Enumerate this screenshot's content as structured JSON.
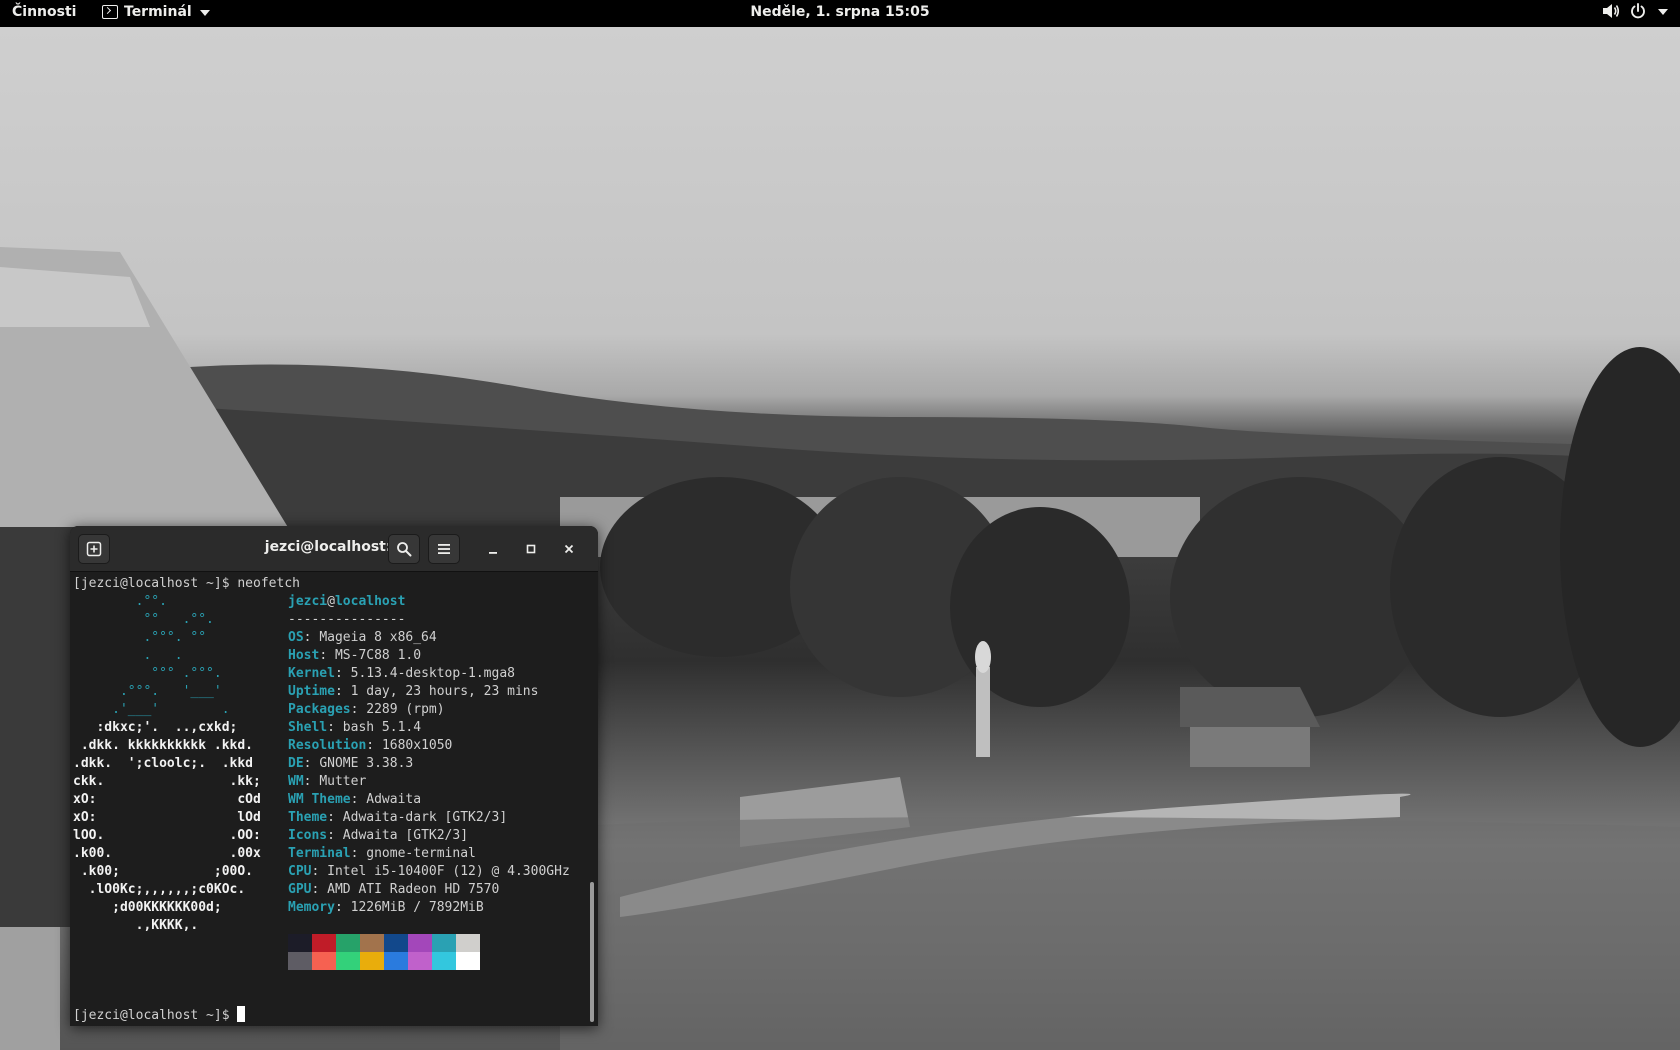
{
  "topbar": {
    "activities": "Činnosti",
    "app_name": "Terminál",
    "clock": "Neděle, 1. srpna  15:05"
  },
  "terminal": {
    "title": "jezci@localhost:~",
    "command_line": "[jezci@localhost ~]$ neofetch",
    "prompt_line": "[jezci@localhost ~]$ ",
    "user": "jezci",
    "at": "@",
    "host": "localhost",
    "separator": "---------------",
    "ascii_art": [
      {
        "t": "        .°°.",
        "c": "c"
      },
      {
        "t": "         °°   .°°.",
        "c": "c"
      },
      {
        "t": "         .°°°. °°",
        "c": "c"
      },
      {
        "t": "         .   .",
        "c": "c"
      },
      {
        "t": "          °°° .°°°.",
        "c": "c"
      },
      {
        "t": "      .°°°.   '___'",
        "c": "c"
      },
      {
        "t": "     .'___'        .",
        "c": "c"
      },
      {
        "t": "   :dkxc;'.  ..,cxkd;",
        "c": "w"
      },
      {
        "t": " .dkk. kkkkkkkkkk .kkd.",
        "c": "w"
      },
      {
        "t": ".dkk.  ';cloolc;.  .kkd",
        "c": "w"
      },
      {
        "t": "ckk.                .kk;",
        "c": "w"
      },
      {
        "t": "xO:                  cOd",
        "c": "w"
      },
      {
        "t": "xO:                  lOd",
        "c": "w"
      },
      {
        "t": "lOO.                .OO:",
        "c": "w"
      },
      {
        "t": ".k00.               .00x",
        "c": "w"
      },
      {
        "t": " .k00;            ;00O.",
        "c": "w"
      },
      {
        "t": "  .lO0Kc;,,,,,,;c0KOc.",
        "c": "w"
      },
      {
        "t": "     ;d00KKKKKK00d;",
        "c": "w"
      },
      {
        "t": "        .,KKKK,.",
        "c": "w"
      }
    ],
    "info": [
      {
        "k": "OS",
        "v": "Mageia 8 x86_64"
      },
      {
        "k": "Host",
        "v": "MS-7C88 1.0"
      },
      {
        "k": "Kernel",
        "v": "5.13.4-desktop-1.mga8"
      },
      {
        "k": "Uptime",
        "v": "1 day, 23 hours, 23 mins"
      },
      {
        "k": "Packages",
        "v": "2289 (rpm)"
      },
      {
        "k": "Shell",
        "v": "bash 5.1.4"
      },
      {
        "k": "Resolution",
        "v": "1680x1050"
      },
      {
        "k": "DE",
        "v": "GNOME 3.38.3"
      },
      {
        "k": "WM",
        "v": "Mutter"
      },
      {
        "k": "WM Theme",
        "v": "Adwaita"
      },
      {
        "k": "Theme",
        "v": "Adwaita-dark [GTK2/3]"
      },
      {
        "k": "Icons",
        "v": "Adwaita [GTK2/3]"
      },
      {
        "k": "Terminal",
        "v": "gnome-terminal"
      },
      {
        "k": "CPU",
        "v": "Intel i5-10400F (12) @ 4.300GHz"
      },
      {
        "k": "GPU",
        "v": "AMD ATI Radeon HD 7570"
      },
      {
        "k": "Memory",
        "v": "1226MiB / 7892MiB"
      }
    ],
    "palette_top": [
      "#1c1c28",
      "#c01c28",
      "#26a269",
      "#a2734c",
      "#12488b",
      "#a347ba",
      "#2aa1b3",
      "#d0cfcc"
    ],
    "palette_bottom": [
      "#5e5c64",
      "#f66151",
      "#33d17a",
      "#e9ad0c",
      "#2a7bde",
      "#c061cb",
      "#33c7de",
      "#ffffff"
    ]
  },
  "icons": {
    "new_tab": "new-tab-icon",
    "search": "search-icon",
    "menu": "hamburger-menu-icon",
    "minimize": "minimize-icon",
    "maximize": "maximize-icon",
    "close": "close-icon",
    "volume": "volume-icon",
    "power": "power-icon"
  },
  "colors": {
    "accent": "#2aa1b3",
    "topbar_bg": "#000000",
    "terminal_bg": "#1d1d1d",
    "headerbar_bg": "#2b2b2b"
  }
}
